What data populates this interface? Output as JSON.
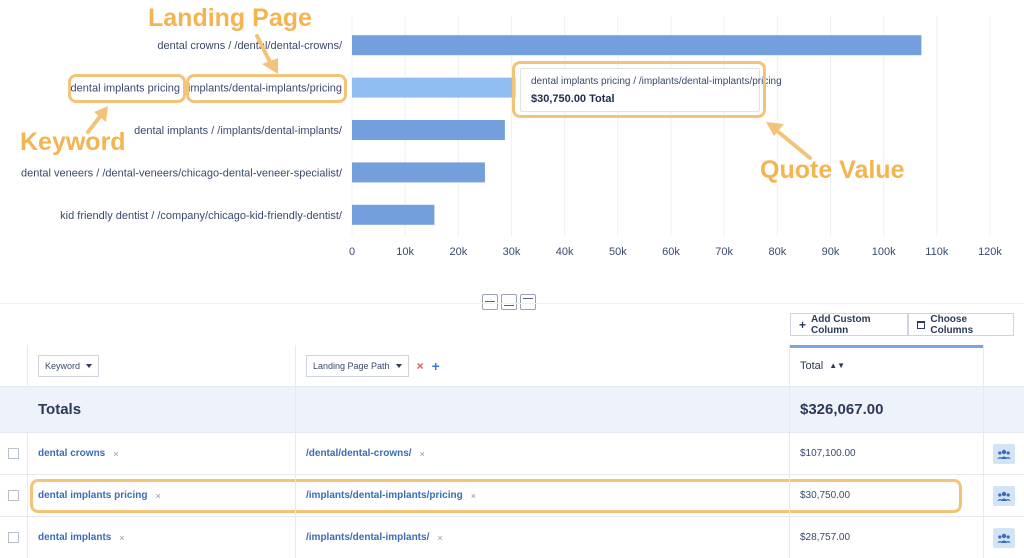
{
  "chart_data": {
    "type": "bar",
    "orientation": "horizontal",
    "categories": [
      "dental crowns / /dental/dental-crowns/",
      "dental implants pricing / /implants/dental-implants/pricing",
      "dental implants / /implants/dental-implants/",
      "dental veneers / /dental-veneers/chicago-dental-veneer-specialist/",
      "kid friendly dentist / /company/chicago-kid-friendly-dentist/"
    ],
    "values": [
      107100,
      30750,
      28757,
      25000,
      15500
    ],
    "highlighted_index": 1,
    "xlim": [
      0,
      120000
    ],
    "xticks": [
      "0",
      "10k",
      "20k",
      "30k",
      "40k",
      "50k",
      "60k",
      "70k",
      "80k",
      "90k",
      "100k",
      "110k",
      "120k"
    ],
    "grid": true,
    "colors": {
      "bar": "#739fdc",
      "bar_highlight": "#91bdf5"
    },
    "ylabel_parts": [
      null,
      {
        "keyword": "dental implants pricing",
        "path": "implants/dental-implants/pricing"
      },
      null,
      null,
      null
    ]
  },
  "tooltip": {
    "title": "dental implants pricing / /implants/dental-implants/pricing",
    "value": "$30,750.00 Total"
  },
  "annotations": {
    "landing_page": "Landing Page",
    "keyword": "Keyword",
    "quote_value": "Quote Value",
    "color": "#f4b451"
  },
  "toolbar": {
    "add_custom_column": "Add Custom Column",
    "choose_columns": "Choose Columns"
  },
  "table": {
    "headers": {
      "keyword": "Keyword",
      "landing_page_path": "Landing Page Path",
      "total": "Total"
    },
    "totals": {
      "label": "Totals",
      "value": "$326,067.00"
    },
    "rows": [
      {
        "keyword": "dental crowns",
        "path": "/dental/dental-crowns/",
        "total": "$107,100.00"
      },
      {
        "keyword": "dental implants pricing",
        "path": "/implants/dental-implants/pricing",
        "total": "$30,750.00"
      },
      {
        "keyword": "dental implants",
        "path": "/implants/dental-implants/",
        "total": "$28,757.00"
      }
    ],
    "remove_glyph": "×",
    "add_glyph": "+"
  }
}
